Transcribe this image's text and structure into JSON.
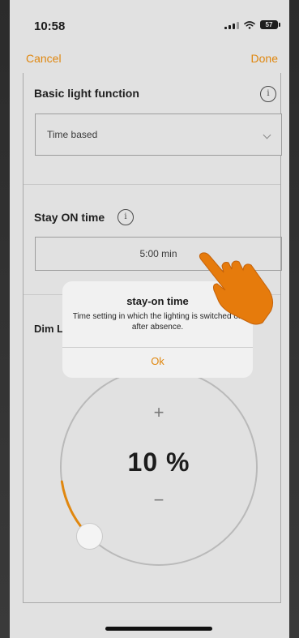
{
  "status_bar": {
    "time": "10:58",
    "battery": "57"
  },
  "nav": {
    "cancel_label": "Cancel",
    "done_label": "Done"
  },
  "basic_light": {
    "title": "Basic light function",
    "info_glyph": "i",
    "selected_value": "Time based"
  },
  "stay_on": {
    "title": "Stay ON time",
    "info_glyph": "i",
    "value": "5:00 min"
  },
  "dim": {
    "label_visible": "Dim L",
    "value_text": "10 %",
    "plus_glyph": "+",
    "minus_glyph": "−",
    "level_fraction": 0.1
  },
  "alert": {
    "title": "stay-on time",
    "message": "Time setting in which the lighting is switched off after absence.",
    "ok_label": "Ok"
  },
  "colors": {
    "accent": "#e0870f",
    "background": "#e1e1e1",
    "alert_bg": "#f1f1f1",
    "dial_track": "#b9b9b9"
  },
  "icons": [
    "signal-icon",
    "wifi-icon",
    "battery-icon",
    "info-icon",
    "chevron-down-icon",
    "hand-pointer-icon"
  ]
}
